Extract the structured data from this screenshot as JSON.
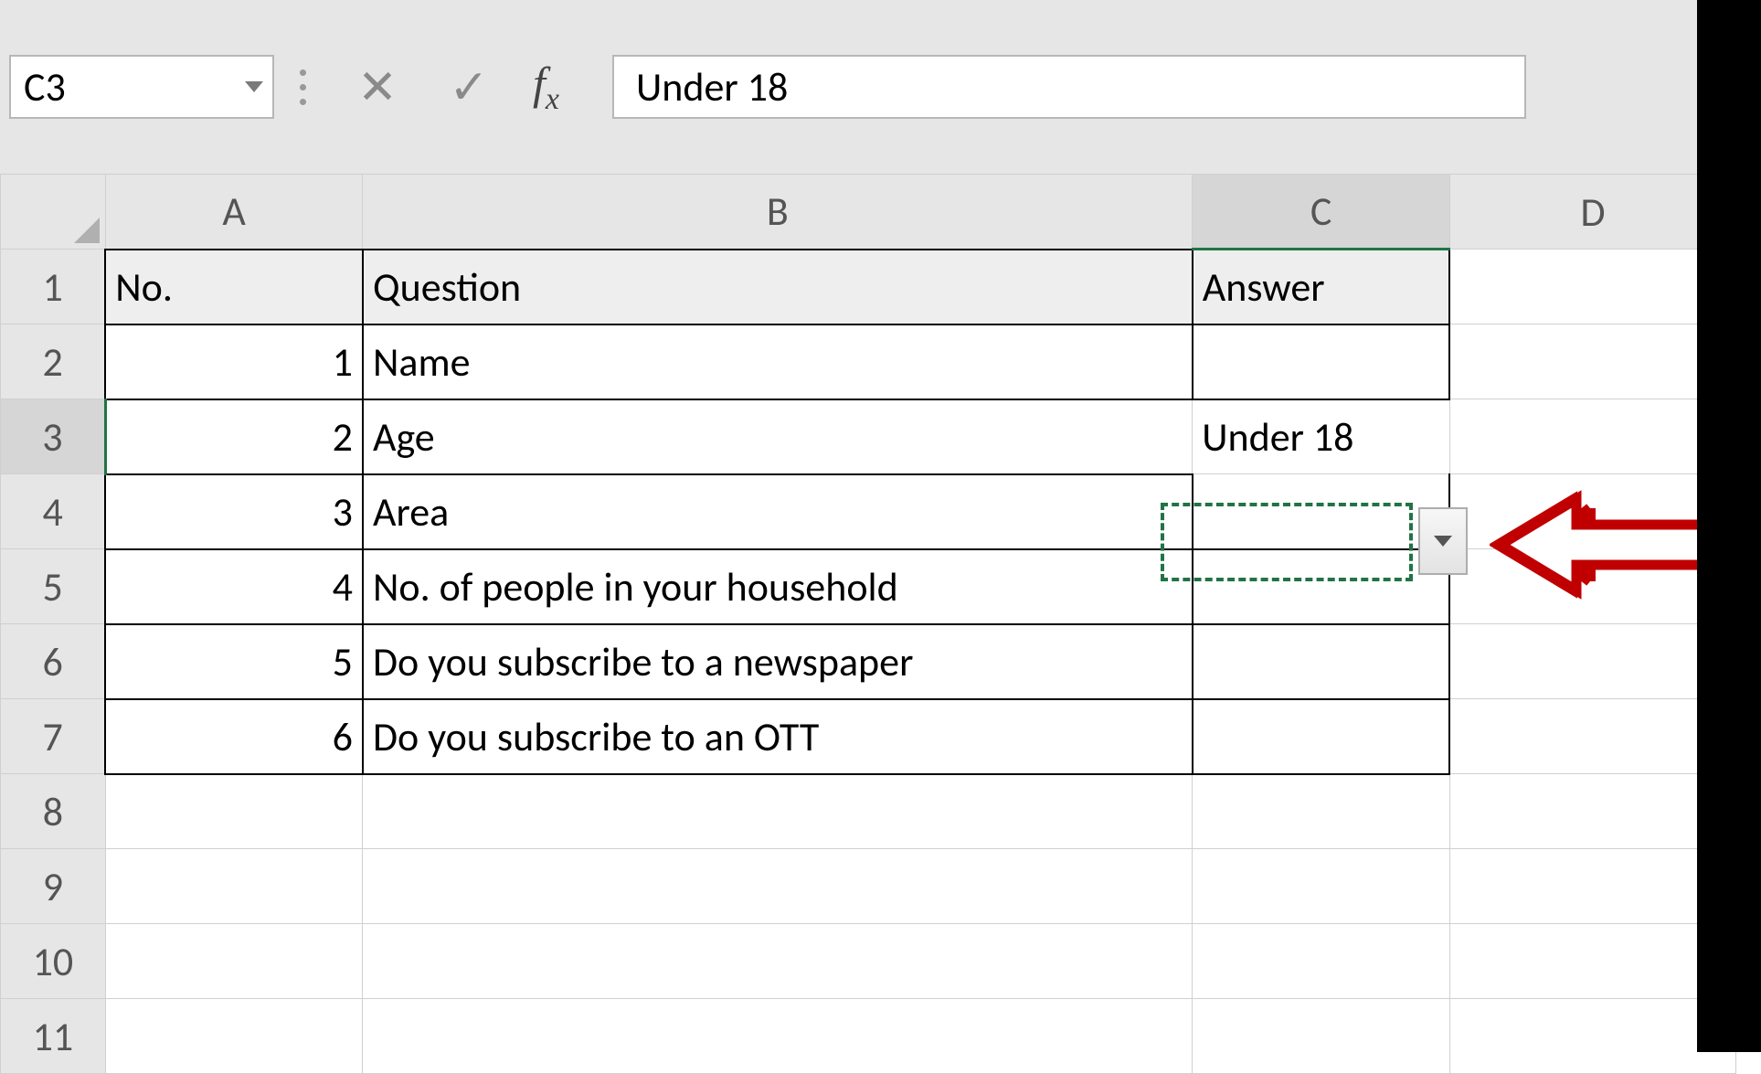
{
  "formulaBar": {
    "nameBox": "C3",
    "fxLabel": "f",
    "fxSub": "x",
    "formulaValue": "Under 18"
  },
  "columns": [
    "A",
    "B",
    "C",
    "D"
  ],
  "rowNumbers": [
    "1",
    "2",
    "3",
    "4",
    "5",
    "6",
    "7",
    "8",
    "9",
    "10",
    "11"
  ],
  "header": {
    "a": "No.",
    "b": "Question",
    "c": "Answer"
  },
  "rows": [
    {
      "no": "1",
      "question": "Name",
      "answer": ""
    },
    {
      "no": "2",
      "question": "Age",
      "answer": "Under 18"
    },
    {
      "no": "3",
      "question": "Area",
      "answer": ""
    },
    {
      "no": "4",
      "question": "No. of people in your household",
      "answer": ""
    },
    {
      "no": "5",
      "question": "Do you subscribe to a newspaper",
      "answer": ""
    },
    {
      "no": "6",
      "question": "Do you subscribe to an OTT",
      "answer": ""
    }
  ],
  "activeCell": "C3",
  "icons": {
    "cancel": "✕",
    "confirm": "✓"
  }
}
